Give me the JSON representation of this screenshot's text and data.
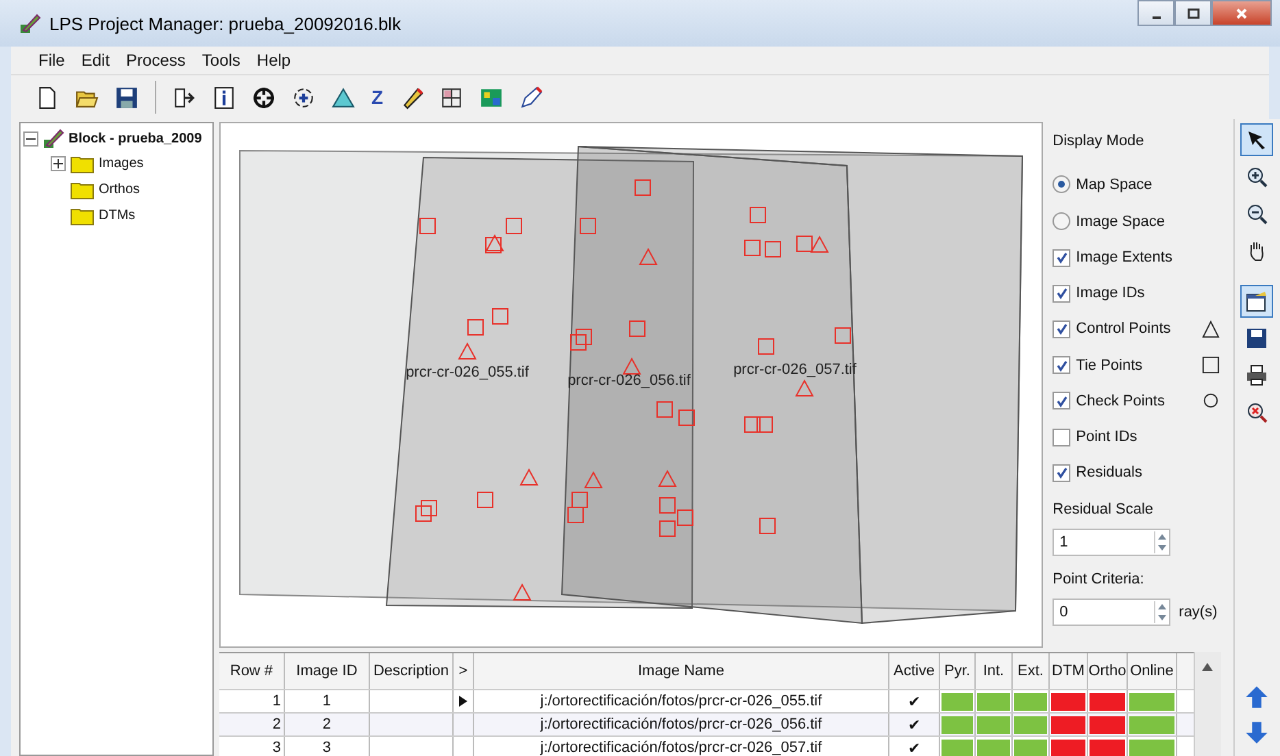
{
  "window": {
    "title": "LPS Project Manager: prueba_20092016.blk"
  },
  "menu": [
    "File",
    "Edit",
    "Process",
    "Tools",
    "Help"
  ],
  "toolbar": {
    "z_label": "Z"
  },
  "tree": {
    "label": "Block - prueba_2009",
    "expanded": true,
    "children": [
      {
        "label": "Images",
        "expanded": false
      },
      {
        "label": "Orthos"
      },
      {
        "label": "DTMs"
      }
    ]
  },
  "canvas": {
    "footprints": [
      {
        "label": "prcr-cr-026_055.tif"
      },
      {
        "label": "prcr-cr-026_056.tif"
      },
      {
        "label": "prcr-cr-026_057.tif"
      }
    ]
  },
  "display_panel": {
    "title": "Display Mode",
    "modes": [
      {
        "label": "Map Space",
        "selected": true
      },
      {
        "label": "Image Space",
        "selected": false
      }
    ],
    "options": [
      {
        "label": "Image Extents",
        "checked": true,
        "kind": "plain"
      },
      {
        "label": "Image IDs",
        "checked": true,
        "kind": "plain"
      },
      {
        "label": "Control Points",
        "checked": true,
        "kind": "triangle"
      },
      {
        "label": "Tie Points",
        "checked": true,
        "kind": "square"
      },
      {
        "label": "Check Points",
        "checked": true,
        "kind": "circle"
      },
      {
        "label": "Point IDs",
        "checked": false,
        "kind": "plain"
      },
      {
        "label": "Residuals",
        "checked": true,
        "kind": "plain"
      }
    ],
    "residual_scale": {
      "label": "Residual Scale",
      "value": "1"
    },
    "point_criteria": {
      "label": "Point Criteria:",
      "value": "0",
      "unit": "ray(s)"
    }
  },
  "tools": [
    {
      "kind": "pointer",
      "selected": true
    },
    {
      "kind": "zoom-in",
      "selected": false
    },
    {
      "kind": "zoom-out",
      "selected": false
    },
    {
      "kind": "pan",
      "selected": false
    },
    {
      "kind": "properties",
      "selected": true
    },
    {
      "kind": "save",
      "selected": false
    },
    {
      "kind": "print",
      "selected": false
    },
    {
      "kind": "clear",
      "selected": false
    }
  ],
  "table": {
    "columns": [
      "Row #",
      "Image ID",
      "Description",
      ">",
      "Image Name",
      "Active",
      "Pyr.",
      "Int.",
      "Ext.",
      "DTM",
      "Ortho",
      "Online"
    ],
    "rows": [
      {
        "row": "1",
        "id": "1",
        "current": true,
        "name": "j:/ortorectificación/fotos/prcr-cr-026_055.tif",
        "active": "✔",
        "status": [
          {
            "color": "#7dc242"
          },
          {
            "color": "#7dc242"
          },
          {
            "color": "#7dc242"
          },
          {
            "color": "#ee1c24"
          },
          {
            "color": "#ee1c24"
          },
          {
            "color": "#7dc242"
          }
        ]
      },
      {
        "row": "2",
        "id": "2",
        "current": false,
        "name": "j:/ortorectificación/fotos/prcr-cr-026_056.tif",
        "active": "✔",
        "status": [
          {
            "color": "#7dc242"
          },
          {
            "color": "#7dc242"
          },
          {
            "color": "#7dc242"
          },
          {
            "color": "#ee1c24"
          },
          {
            "color": "#ee1c24"
          },
          {
            "color": "#7dc242"
          }
        ]
      },
      {
        "row": "3",
        "id": "3",
        "current": false,
        "name": "j:/ortorectificación/fotos/prcr-cr-026_057.tif",
        "active": "✔",
        "status": [
          {
            "color": "#7dc242"
          },
          {
            "color": "#7dc242"
          },
          {
            "color": "#7dc242"
          },
          {
            "color": "#ee1c24"
          },
          {
            "color": "#ee1c24"
          },
          {
            "color": "#7dc242"
          }
        ]
      }
    ]
  }
}
